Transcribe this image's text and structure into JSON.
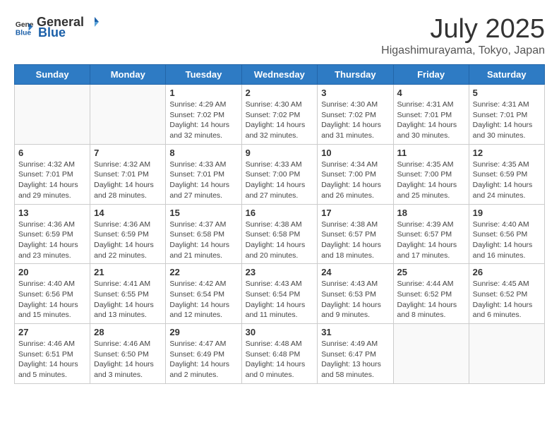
{
  "logo": {
    "general": "General",
    "blue": "Blue"
  },
  "header": {
    "month": "July 2025",
    "location": "Higashimurayama, Tokyo, Japan"
  },
  "weekdays": [
    "Sunday",
    "Monday",
    "Tuesday",
    "Wednesday",
    "Thursday",
    "Friday",
    "Saturday"
  ],
  "weeks": [
    [
      {
        "day": "",
        "info": ""
      },
      {
        "day": "",
        "info": ""
      },
      {
        "day": "1",
        "info": "Sunrise: 4:29 AM\nSunset: 7:02 PM\nDaylight: 14 hours and 32 minutes."
      },
      {
        "day": "2",
        "info": "Sunrise: 4:30 AM\nSunset: 7:02 PM\nDaylight: 14 hours and 32 minutes."
      },
      {
        "day": "3",
        "info": "Sunrise: 4:30 AM\nSunset: 7:02 PM\nDaylight: 14 hours and 31 minutes."
      },
      {
        "day": "4",
        "info": "Sunrise: 4:31 AM\nSunset: 7:01 PM\nDaylight: 14 hours and 30 minutes."
      },
      {
        "day": "5",
        "info": "Sunrise: 4:31 AM\nSunset: 7:01 PM\nDaylight: 14 hours and 30 minutes."
      }
    ],
    [
      {
        "day": "6",
        "info": "Sunrise: 4:32 AM\nSunset: 7:01 PM\nDaylight: 14 hours and 29 minutes."
      },
      {
        "day": "7",
        "info": "Sunrise: 4:32 AM\nSunset: 7:01 PM\nDaylight: 14 hours and 28 minutes."
      },
      {
        "day": "8",
        "info": "Sunrise: 4:33 AM\nSunset: 7:01 PM\nDaylight: 14 hours and 27 minutes."
      },
      {
        "day": "9",
        "info": "Sunrise: 4:33 AM\nSunset: 7:00 PM\nDaylight: 14 hours and 27 minutes."
      },
      {
        "day": "10",
        "info": "Sunrise: 4:34 AM\nSunset: 7:00 PM\nDaylight: 14 hours and 26 minutes."
      },
      {
        "day": "11",
        "info": "Sunrise: 4:35 AM\nSunset: 7:00 PM\nDaylight: 14 hours and 25 minutes."
      },
      {
        "day": "12",
        "info": "Sunrise: 4:35 AM\nSunset: 6:59 PM\nDaylight: 14 hours and 24 minutes."
      }
    ],
    [
      {
        "day": "13",
        "info": "Sunrise: 4:36 AM\nSunset: 6:59 PM\nDaylight: 14 hours and 23 minutes."
      },
      {
        "day": "14",
        "info": "Sunrise: 4:36 AM\nSunset: 6:59 PM\nDaylight: 14 hours and 22 minutes."
      },
      {
        "day": "15",
        "info": "Sunrise: 4:37 AM\nSunset: 6:58 PM\nDaylight: 14 hours and 21 minutes."
      },
      {
        "day": "16",
        "info": "Sunrise: 4:38 AM\nSunset: 6:58 PM\nDaylight: 14 hours and 20 minutes."
      },
      {
        "day": "17",
        "info": "Sunrise: 4:38 AM\nSunset: 6:57 PM\nDaylight: 14 hours and 18 minutes."
      },
      {
        "day": "18",
        "info": "Sunrise: 4:39 AM\nSunset: 6:57 PM\nDaylight: 14 hours and 17 minutes."
      },
      {
        "day": "19",
        "info": "Sunrise: 4:40 AM\nSunset: 6:56 PM\nDaylight: 14 hours and 16 minutes."
      }
    ],
    [
      {
        "day": "20",
        "info": "Sunrise: 4:40 AM\nSunset: 6:56 PM\nDaylight: 14 hours and 15 minutes."
      },
      {
        "day": "21",
        "info": "Sunrise: 4:41 AM\nSunset: 6:55 PM\nDaylight: 14 hours and 13 minutes."
      },
      {
        "day": "22",
        "info": "Sunrise: 4:42 AM\nSunset: 6:54 PM\nDaylight: 14 hours and 12 minutes."
      },
      {
        "day": "23",
        "info": "Sunrise: 4:43 AM\nSunset: 6:54 PM\nDaylight: 14 hours and 11 minutes."
      },
      {
        "day": "24",
        "info": "Sunrise: 4:43 AM\nSunset: 6:53 PM\nDaylight: 14 hours and 9 minutes."
      },
      {
        "day": "25",
        "info": "Sunrise: 4:44 AM\nSunset: 6:52 PM\nDaylight: 14 hours and 8 minutes."
      },
      {
        "day": "26",
        "info": "Sunrise: 4:45 AM\nSunset: 6:52 PM\nDaylight: 14 hours and 6 minutes."
      }
    ],
    [
      {
        "day": "27",
        "info": "Sunrise: 4:46 AM\nSunset: 6:51 PM\nDaylight: 14 hours and 5 minutes."
      },
      {
        "day": "28",
        "info": "Sunrise: 4:46 AM\nSunset: 6:50 PM\nDaylight: 14 hours and 3 minutes."
      },
      {
        "day": "29",
        "info": "Sunrise: 4:47 AM\nSunset: 6:49 PM\nDaylight: 14 hours and 2 minutes."
      },
      {
        "day": "30",
        "info": "Sunrise: 4:48 AM\nSunset: 6:48 PM\nDaylight: 14 hours and 0 minutes."
      },
      {
        "day": "31",
        "info": "Sunrise: 4:49 AM\nSunset: 6:47 PM\nDaylight: 13 hours and 58 minutes."
      },
      {
        "day": "",
        "info": ""
      },
      {
        "day": "",
        "info": ""
      }
    ]
  ]
}
